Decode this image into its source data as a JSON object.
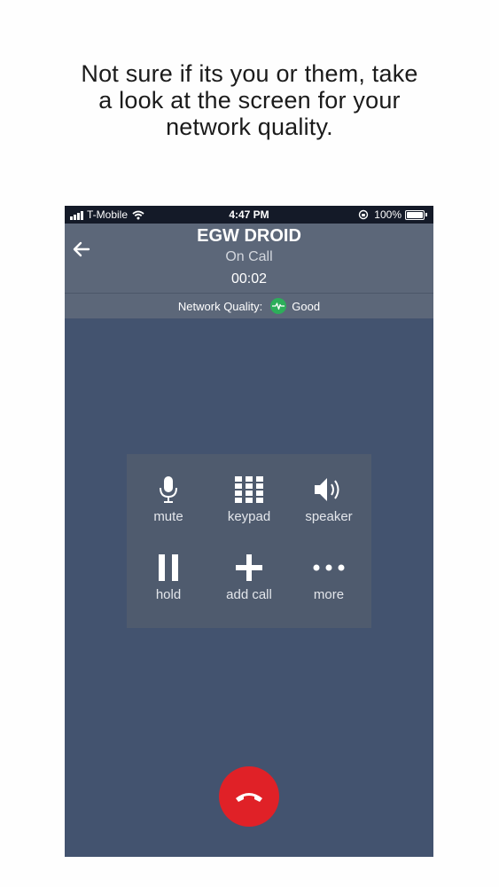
{
  "caption": {
    "line1": "Not sure if its you or them, take",
    "line2": "a look at the screen for your",
    "line3": "network quality."
  },
  "status_bar": {
    "carrier": "T-Mobile",
    "time": "4:47 PM",
    "battery": "100%"
  },
  "call": {
    "name": "EGW DROID",
    "status": "On Call",
    "timer": "00:02"
  },
  "network": {
    "label": "Network Quality:",
    "value": "Good",
    "value_color": "#2dae5a"
  },
  "controls": {
    "mute": "mute",
    "keypad": "keypad",
    "speaker": "speaker",
    "hold": "hold",
    "add_call": "add call",
    "more": "more"
  },
  "colors": {
    "screen_bg": "#43536f",
    "header_bg": "#5c6779",
    "end_call": "#e02127"
  }
}
